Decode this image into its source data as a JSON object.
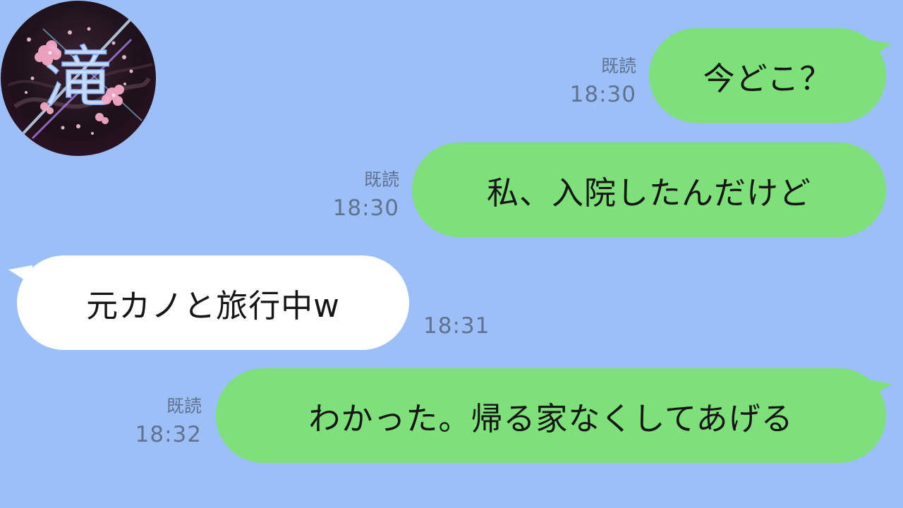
{
  "contact": {
    "avatar_icon": "sakura-kanji-avatar",
    "avatar_text": "滝"
  },
  "messages": [
    {
      "direction": "sent",
      "text": "今どこ？",
      "read": "既読",
      "time": "18:30"
    },
    {
      "direction": "sent",
      "text": "私、入院したんだけど",
      "read": "既読",
      "time": "18:30"
    },
    {
      "direction": "received",
      "text": "元カノと旅行中w",
      "time": "18:31"
    },
    {
      "direction": "sent",
      "text": "わかった。帰る家なくしてあげる",
      "read": "既読",
      "time": "18:32"
    }
  ],
  "colors": {
    "background": "#9dbff8",
    "sent_bubble": "#7de079",
    "received_bubble": "#ffffff",
    "meta_text": "#5f7290"
  }
}
